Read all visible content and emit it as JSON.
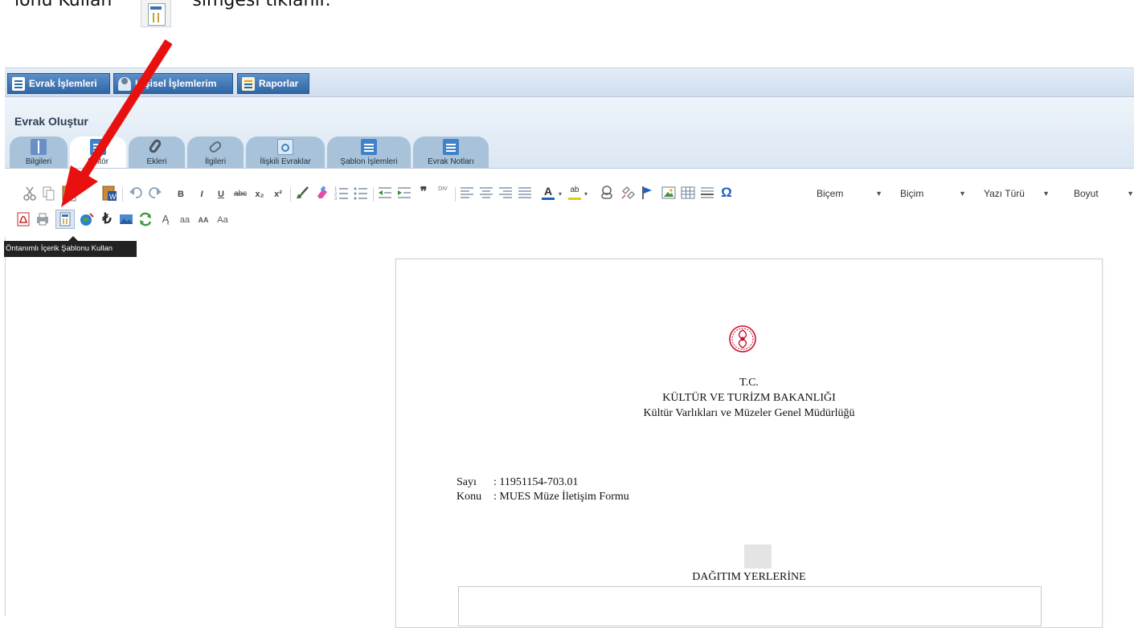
{
  "caption": {
    "before": "lonu Kullan",
    "after": "simgesi tıklanır.",
    "icon": "template-icon"
  },
  "topnav": [
    {
      "label": "Evrak İşlemleri",
      "icon": "document-icon"
    },
    {
      "label": "Kişisel İşlemlerim",
      "icon": "person-icon"
    },
    {
      "label": "Raporlar",
      "icon": "report-icon"
    }
  ],
  "panel": {
    "title": "Evrak Oluştur",
    "tabs": [
      {
        "label": "Bilgileri",
        "icon": "book-icon"
      },
      {
        "label": "Editör",
        "icon": "document-icon",
        "active": true
      },
      {
        "label": "Ekleri",
        "icon": "paperclip-icon"
      },
      {
        "label": "İlgileri",
        "icon": "link-icon"
      },
      {
        "label": "İlişkili Evraklar",
        "icon": "related-docs-icon"
      },
      {
        "label": "Şablon İşlemleri",
        "icon": "document-icon"
      },
      {
        "label": "Evrak Notları",
        "icon": "note-edit-icon"
      }
    ]
  },
  "toolbar": {
    "dropdowns": [
      {
        "label": "Biçem"
      },
      {
        "label": "Biçim"
      },
      {
        "label": "Yazı Türü"
      },
      {
        "label": "Boyut"
      }
    ],
    "text_buttons": {
      "bold": "B",
      "italic": "I",
      "underline": "U",
      "strike": "abc",
      "subscript": "x₂",
      "superscript": "x²",
      "quote": "❞",
      "div": "DIV",
      "omega": "Ω",
      "font_color": "A",
      "bg_color": "ab",
      "lower": "aa",
      "upper": "AA",
      "title": "Aa",
      "turkish": "₺",
      "translit": "Ą"
    },
    "tooltip": "Öntanımlı İçerik Şablonu Kullan"
  },
  "document": {
    "line1": "T.C.",
    "line2": "KÜLTÜR VE TURİZM BAKANLIĞI",
    "line3": "Kültür Varlıkları ve Müzeler Genel Müdürlüğü",
    "sayi_label": "Sayı",
    "sayi_value": ": 11951154-703.01",
    "konu_label": "Konu",
    "konu_value": ": MUES Müze İletişim Formu",
    "distribution": "DAĞITIM YERLERİNE"
  },
  "colors": {
    "nav_button": "#2f66a6",
    "tab_inactive": "#a8c3d9",
    "arrow": "#e8110f",
    "seal": "#c8102e"
  }
}
